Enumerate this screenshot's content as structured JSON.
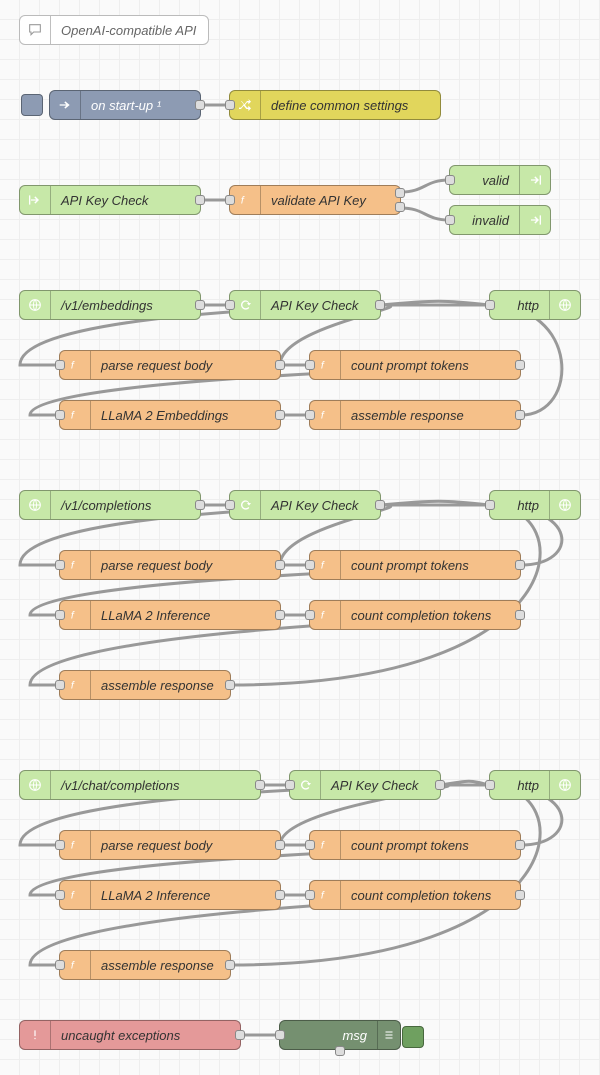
{
  "comment": {
    "label": "OpenAI-compatible API"
  },
  "startup": {
    "inject_label": "on start-up ¹",
    "define_label": "define common settings"
  },
  "apikey": {
    "link_in": "API Key Check",
    "validate": "validate API Key",
    "valid": "valid",
    "invalid": "invalid"
  },
  "embeddings": {
    "route": "/v1/embeddings",
    "link_call": "API Key Check",
    "http": "http",
    "parse": "parse request body",
    "count_prompt": "count prompt tokens",
    "llama": "LLaMA 2 Embeddings",
    "assemble": "assemble response"
  },
  "completions": {
    "route": "/v1/completions",
    "link_call": "API Key Check",
    "http": "http",
    "parse": "parse request body",
    "count_prompt": "count prompt tokens",
    "llama": "LLaMA 2 Inference",
    "count_completion": "count completion tokens",
    "assemble": "assemble response"
  },
  "chat": {
    "route": "/v1/chat/completions",
    "link_call": "API Key Check",
    "http": "http",
    "parse": "parse request body",
    "count_prompt": "count prompt tokens",
    "llama": "LLaMA 2 Inference",
    "count_completion": "count completion tokens",
    "assemble": "assemble response"
  },
  "errors": {
    "catch": "uncaught exceptions",
    "debug": "msg"
  }
}
